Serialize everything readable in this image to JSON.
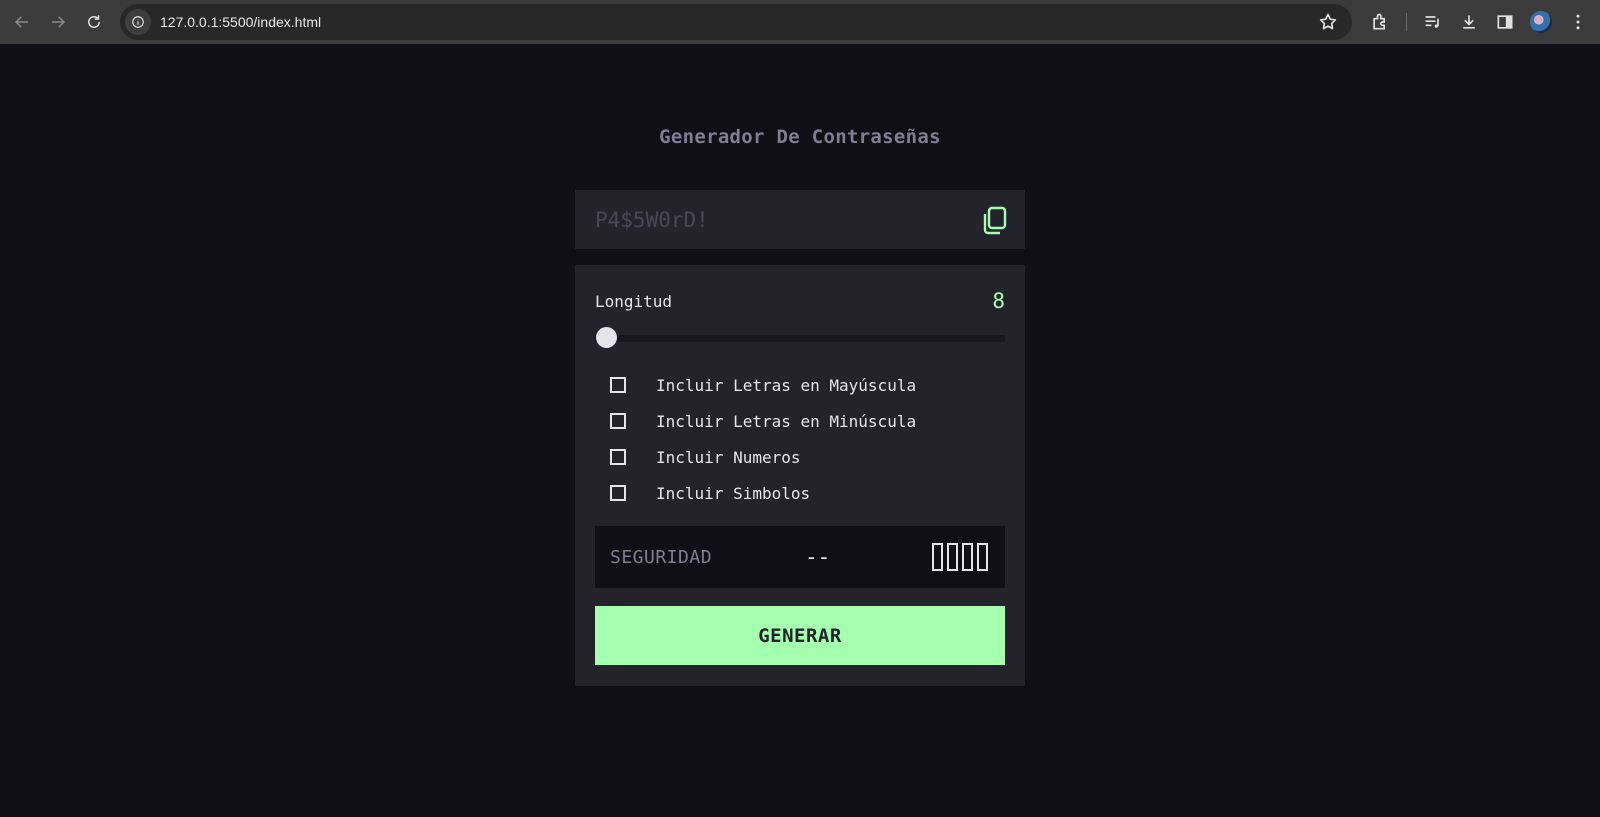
{
  "browser": {
    "url": "127.0.0.1:5500/index.html",
    "icons": [
      "back-icon",
      "forward-icon",
      "reload-icon",
      "site-info-icon",
      "bookmark-star-icon",
      "extensions-icon",
      "media-control-icon",
      "downloads-icon",
      "side-panel-icon",
      "profile-avatar",
      "more-menu-icon"
    ]
  },
  "app": {
    "title": "Generador De Contraseñas",
    "password_placeholder": "P4$5W0rD!",
    "length_label": "Longitud",
    "length_value": "8",
    "slider_fraction": 0,
    "options": [
      {
        "label": "Incluir Letras en Mayúscula",
        "checked": false
      },
      {
        "label": "Incluir Letras en Minúscula",
        "checked": false
      },
      {
        "label": "Incluir Numeros",
        "checked": false
      },
      {
        "label": "Incluir Simbolos",
        "checked": false
      }
    ],
    "strength_label": "SEGURIDAD",
    "strength_value": "--",
    "strength_bars": 4,
    "generate_label": "GENERAR"
  },
  "colors": {
    "background": "#100f15",
    "panel": "#24232c",
    "accent": "#a4ffaf",
    "muted": "#817d92",
    "text": "#e6e5ea"
  }
}
